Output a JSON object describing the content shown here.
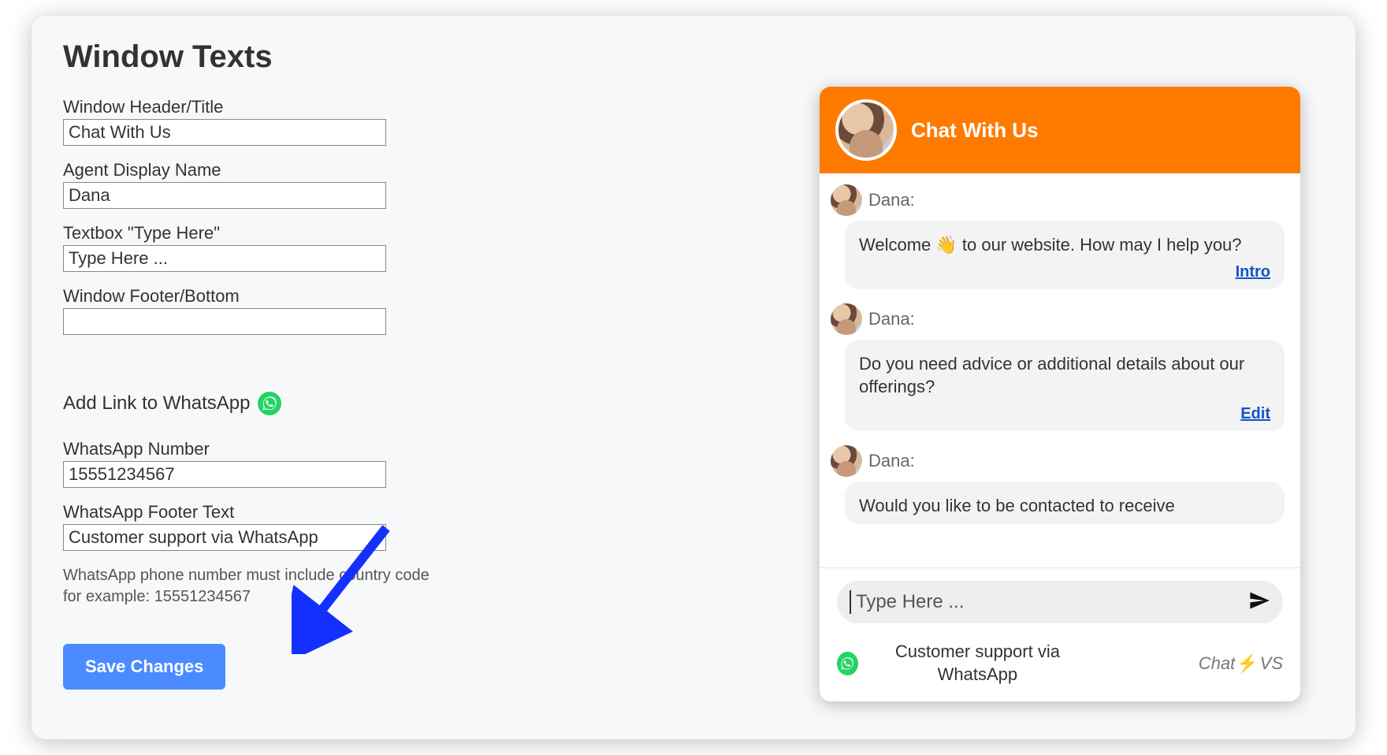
{
  "section": {
    "heading": "Window Texts"
  },
  "form": {
    "window_header_label": "Window Header/Title",
    "window_header_value": "Chat With Us",
    "agent_name_label": "Agent Display Name",
    "agent_name_value": "Dana",
    "type_here_label": "Textbox \"Type Here\"",
    "type_here_value": "Type Here ...",
    "footer_label": "Window Footer/Bottom",
    "footer_value": ""
  },
  "whatsapp": {
    "heading": "Add Link to WhatsApp",
    "number_label": "WhatsApp Number",
    "number_value": "15551234567",
    "footer_text_label": "WhatsApp Footer Text",
    "footer_text_value": "Customer support via WhatsApp",
    "hint_line1": "WhatsApp phone number must include country code",
    "hint_line2": "for example: 15551234567"
  },
  "actions": {
    "save_label": "Save Changes"
  },
  "preview": {
    "header_title": "Chat With Us",
    "agent_name": "Dana:",
    "messages": [
      {
        "text": "Welcome 👋 to our website. How may I help you?",
        "link": "Intro"
      },
      {
        "text": "Do you need advice or additional details about our offerings?",
        "link": "Edit"
      },
      {
        "text": "Would you like to be contacted to receive",
        "link": ""
      }
    ],
    "input_placeholder": "Type Here ...",
    "footer_whatsapp_text": "Customer support via WhatsApp",
    "brand_prefix": "Chat",
    "brand_suffix": "VS"
  }
}
